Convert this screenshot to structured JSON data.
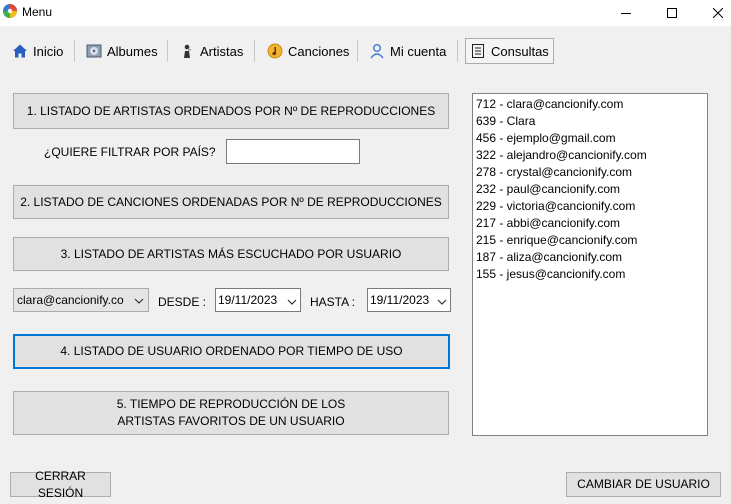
{
  "window": {
    "title": "Menu",
    "icon": "app-disc-icon"
  },
  "tabs": [
    {
      "label": "Inicio",
      "icon": "home-icon"
    },
    {
      "label": "Albumes",
      "icon": "album-icon"
    },
    {
      "label": "Artistas",
      "icon": "artist-icon"
    },
    {
      "label": "Canciones",
      "icon": "song-icon"
    },
    {
      "label": "Mi cuenta",
      "icon": "user-icon"
    },
    {
      "label": "Consultas",
      "icon": "list-icon",
      "active": true
    }
  ],
  "queries": {
    "q1_label": "1. LISTADO DE ARTISTAS ORDENADOS POR Nº DE REPRODUCCIONES",
    "filter_country_label": "¿QUIERE FILTRAR POR PAÍS?",
    "filter_country_value": "",
    "q2_label": "2. LISTADO DE CANCIONES ORDENADAS POR Nº DE REPRODUCCIONES",
    "q3_label": "3. LISTADO DE ARTISTAS MÁS ESCUCHADO POR USUARIO",
    "user_select_value": "clara@cancionify.co",
    "desde_label": "DESDE :",
    "desde_value": "19/11/2023",
    "hasta_label": "HASTA :",
    "hasta_value": "19/11/2023",
    "q4_label": "4. LISTADO DE USUARIO ORDENADO POR TIEMPO DE USO",
    "q5_label_line1": "5. TIEMPO DE REPRODUCCIÓN DE LOS",
    "q5_label_line2": "ARTISTAS FAVORITOS DE UN USUARIO"
  },
  "results": [
    "712 - clara@cancionify.com",
    "639 - Clara",
    "456 - ejemplo@gmail.com",
    "322 - alejandro@cancionify.com",
    "278 - crystal@cancionify.com",
    "232 - paul@cancionify.com",
    "229 - victoria@cancionify.com",
    "217 - abbi@cancionify.com",
    "215 - enrique@cancionify.com",
    "187 - aliza@cancionify.com",
    "155 - jesus@cancionify.com"
  ],
  "footer": {
    "logout_label": "CERRAR SESIÓN",
    "switch_user_label": "CAMBIAR DE USUARIO"
  },
  "colors": {
    "focus": "#0078d7",
    "button_bg": "#e1e1e1",
    "window_bg": "#f0f0f0"
  }
}
